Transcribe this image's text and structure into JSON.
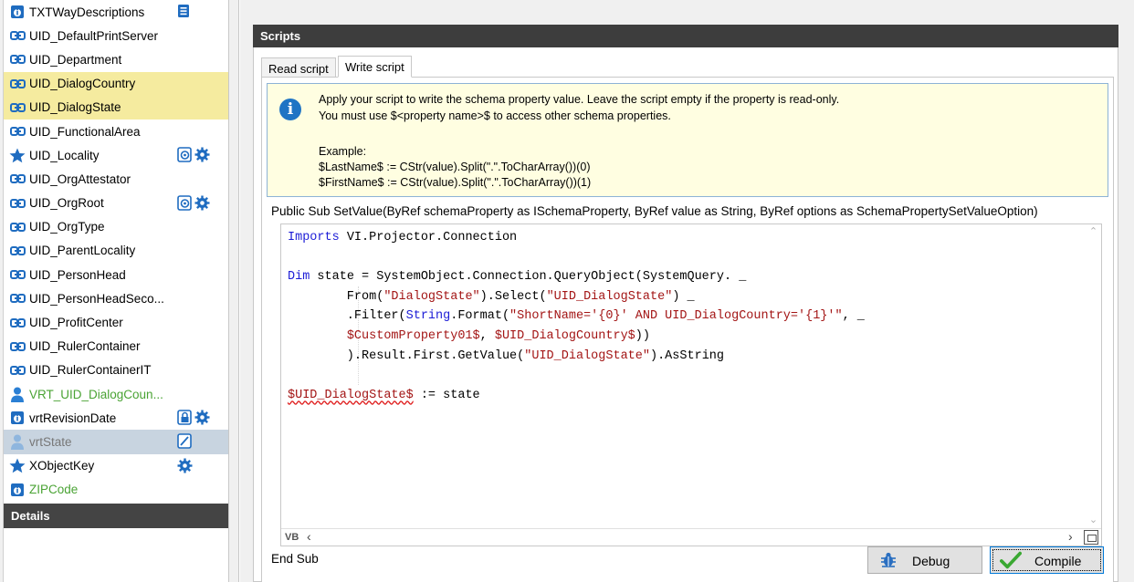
{
  "properties": [
    {
      "label": "TXTWayDescriptions",
      "icon": "info-square-icon",
      "style": "normal",
      "badges": [
        "list-icon"
      ]
    },
    {
      "label": "UID_DefaultPrintServer",
      "icon": "link-icon",
      "style": "normal",
      "badges": []
    },
    {
      "label": "UID_Department",
      "icon": "link-icon",
      "style": "normal",
      "badges": []
    },
    {
      "label": "UID_DialogCountry",
      "icon": "link-icon",
      "style": "selected",
      "badges": []
    },
    {
      "label": "UID_DialogState",
      "icon": "link-icon",
      "style": "selected",
      "badges": []
    },
    {
      "label": "UID_FunctionalArea",
      "icon": "link-icon",
      "style": "normal",
      "badges": []
    },
    {
      "label": "UID_Locality",
      "icon": "star-icon",
      "style": "normal",
      "badges": [
        "script-icon",
        "gear-icon"
      ]
    },
    {
      "label": "UID_OrgAttestator",
      "icon": "link-icon",
      "style": "normal",
      "badges": []
    },
    {
      "label": "UID_OrgRoot",
      "icon": "link-icon",
      "style": "normal",
      "badges": [
        "script-icon",
        "gear-icon"
      ]
    },
    {
      "label": "UID_OrgType",
      "icon": "link-icon",
      "style": "normal",
      "badges": []
    },
    {
      "label": "UID_ParentLocality",
      "icon": "link-icon",
      "style": "normal",
      "badges": []
    },
    {
      "label": "UID_PersonHead",
      "icon": "link-icon",
      "style": "normal",
      "badges": []
    },
    {
      "label": "UID_PersonHeadSeco...",
      "icon": "link-icon",
      "style": "normal",
      "badges": []
    },
    {
      "label": "UID_ProfitCenter",
      "icon": "link-icon",
      "style": "normal",
      "badges": []
    },
    {
      "label": "UID_RulerContainer",
      "icon": "link-icon",
      "style": "normal",
      "badges": []
    },
    {
      "label": "UID_RulerContainerIT",
      "icon": "link-icon",
      "style": "normal",
      "badges": []
    },
    {
      "label": "VRT_UID_DialogCoun...",
      "icon": "person-icon",
      "style": "green",
      "badges": []
    },
    {
      "label": "vrtRevisionDate",
      "icon": "info-square-icon",
      "style": "normal",
      "badges": [
        "lock-script-icon",
        "gear-icon"
      ]
    },
    {
      "label": "vrtState",
      "icon": "person-gray-icon",
      "style": "grayed",
      "badges": [
        "edit-script-icon"
      ]
    },
    {
      "label": "XObjectKey",
      "icon": "star-icon",
      "style": "normal",
      "badges": [
        "gear-icon"
      ]
    },
    {
      "label": "ZIPCode",
      "icon": "info-square-icon",
      "style": "green",
      "badges": []
    }
  ],
  "details": {
    "title": "Details"
  },
  "scripts": {
    "title": "Scripts",
    "tabs": {
      "read": "Read script",
      "write": "Write script"
    },
    "info": {
      "line1": "Apply your script to write the schema property value. Leave the script empty if the property is read-only.",
      "line2": "You must use $<property name>$ to access other schema properties.",
      "line3": "Example:",
      "line4": "$LastName$ := CStr(value).Split(\".\".ToCharArray())(0)",
      "line5": "$FirstName$ := CStr(value).Split(\".\".ToCharArray())(1)"
    },
    "signature": "Public Sub SetValue(ByRef schemaProperty as ISchemaProperty, ByRef value as String, ByRef options as SchemaPropertySetValueOption)",
    "code": {
      "l1_kw": "Imports",
      "l1_rest": " VI.Projector.Connection",
      "l3_kw": "Dim",
      "l3_rest": " state = SystemObject.Connection.QueryObject(SystemQuery. _",
      "l4_a": "        From(",
      "l4_s1": "\"DialogState\"",
      "l4_b": ").Select(",
      "l4_s2": "\"UID_DialogState\"",
      "l4_c": ") _",
      "l5_a": "        .Filter(",
      "l5_kw": "String",
      "l5_b": ".Format(",
      "l5_s": "\"ShortName='{0}' AND UID_DialogCountry='{1}'\"",
      "l5_c": ", _",
      "l6_a": "        ",
      "l6_p1": "$CustomProperty01$",
      "l6_b": ", ",
      "l6_p2": "$UID_DialogCountry$",
      "l6_c": "))",
      "l7_a": "        ).Result.First.GetValue(",
      "l7_s": "\"UID_DialogState\"",
      "l7_c": ").AsString",
      "l9_p": "$UID_DialogState$",
      "l9_rest": " := state"
    },
    "editor_lang": "VB",
    "end_sub": "End Sub",
    "debug_label": "Debug",
    "compile_label": "Compile"
  }
}
